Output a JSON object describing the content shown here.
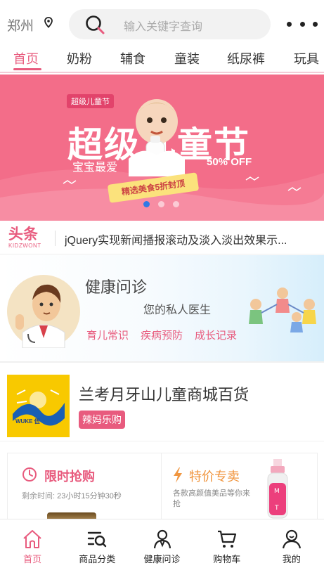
{
  "header": {
    "city": "郑州",
    "search_placeholder": "输入关键字查询",
    "icons": [
      "location-pin-icon",
      "search-icon",
      "more-dots-icon"
    ]
  },
  "tabs": [
    {
      "label": "首页",
      "active": true
    },
    {
      "label": "奶粉",
      "active": false
    },
    {
      "label": "辅食",
      "active": false
    },
    {
      "label": "童装",
      "active": false
    },
    {
      "label": "纸尿裤",
      "active": false
    },
    {
      "label": "玩具",
      "active": false
    }
  ],
  "banner": {
    "tag": "超级儿童节",
    "title": "超级儿童节",
    "subtitle": "宝宝最爱",
    "discount": "50% OFF",
    "ribbon": "精选美食5折封顶",
    "slide_count": 3,
    "active_slide": 1
  },
  "ticker": {
    "logo_main": "头条",
    "logo_sub": "KIDZWONT",
    "text": "jQuery实现新闻播报滚动及淡入淡出效果示..."
  },
  "health": {
    "title": "健康问诊",
    "subtitle": "您的私人医生",
    "links": [
      "育儿常识",
      "疾病预防",
      "成长记录"
    ]
  },
  "store": {
    "logo_text": "WUKE 伍",
    "name": "兰考月牙山儿童商城百货",
    "tag": "辣妈乐购"
  },
  "promo": {
    "flash_title": "限时抢购",
    "flash_time_label": "剩余时间:",
    "flash_time_value": "23小时15分钟30秒",
    "special_title": "特价专卖",
    "special_desc": "各款高颜值美品等你来抢"
  },
  "bottom_nav": [
    {
      "label": "首页",
      "icon": "home-icon",
      "active": true
    },
    {
      "label": "商品分类",
      "icon": "category-icon",
      "active": false
    },
    {
      "label": "健康问诊",
      "icon": "doctor-icon",
      "active": false
    },
    {
      "label": "购物车",
      "icon": "cart-icon",
      "active": false
    },
    {
      "label": "我的",
      "icon": "user-icon",
      "active": false
    }
  ],
  "colors": {
    "accent": "#e85b7e",
    "banner_bg": "#f36d89",
    "special": "#f09640",
    "dot_active": "#2e7ae6"
  }
}
